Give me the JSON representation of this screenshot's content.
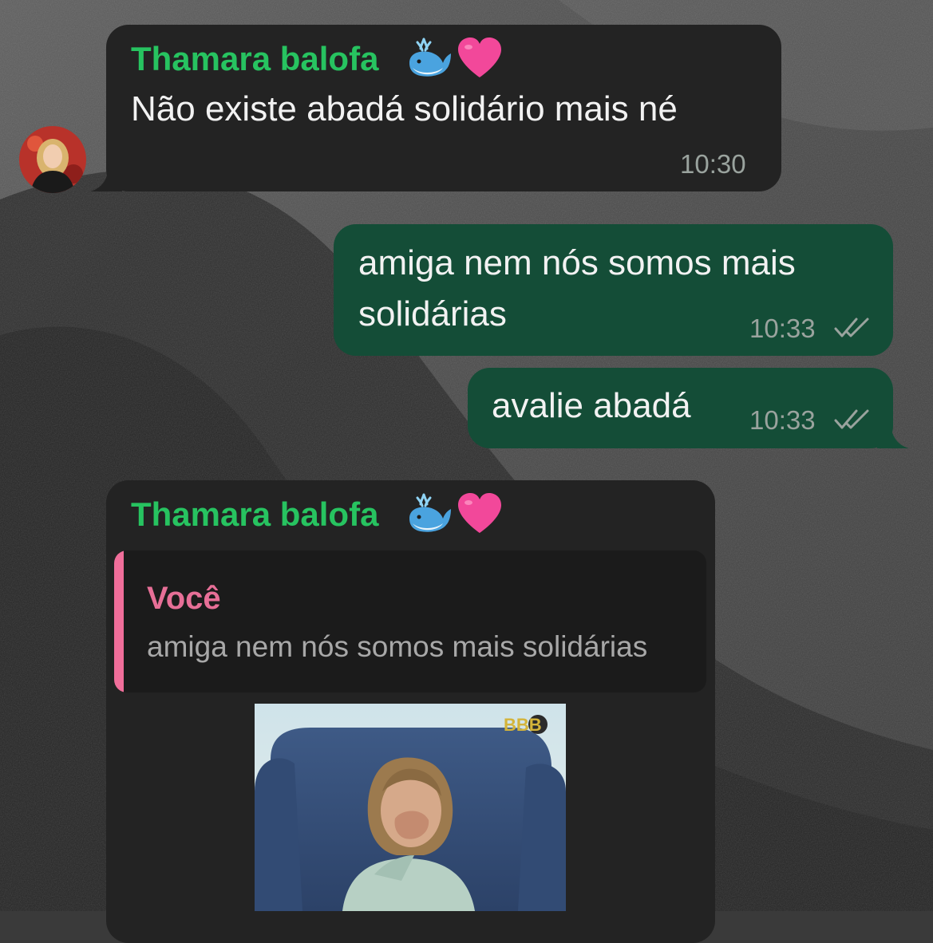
{
  "chat": {
    "messages": [
      {
        "direction": "incoming",
        "sender": "Thamara balofa",
        "sender_emoji": [
          "whale-icon",
          "pink-heart-icon"
        ],
        "text": "Não existe abadá solidário mais né",
        "time": "10:30"
      },
      {
        "direction": "outgoing",
        "text_line1": "amiga nem nós somos mais",
        "text_line2": "solidárias",
        "time": "10:33",
        "status": "read"
      },
      {
        "direction": "outgoing",
        "text": "avalie abadá",
        "time": "10:33",
        "status": "read"
      },
      {
        "direction": "incoming",
        "sender": "Thamara balofa",
        "sender_emoji": [
          "whale-icon",
          "pink-heart-icon"
        ],
        "reply_to": {
          "author": "Você",
          "text": "amiga nem nós somos mais solidárias"
        },
        "media": {
          "type": "gif",
          "watermark": "BBB"
        }
      }
    ]
  },
  "colors": {
    "incoming_bubble": "#232323",
    "outgoing_bubble": "#144d37",
    "sender_name": "#27c360",
    "quote_accent": "#f06e9a",
    "timestamp": "#9aa39e"
  }
}
